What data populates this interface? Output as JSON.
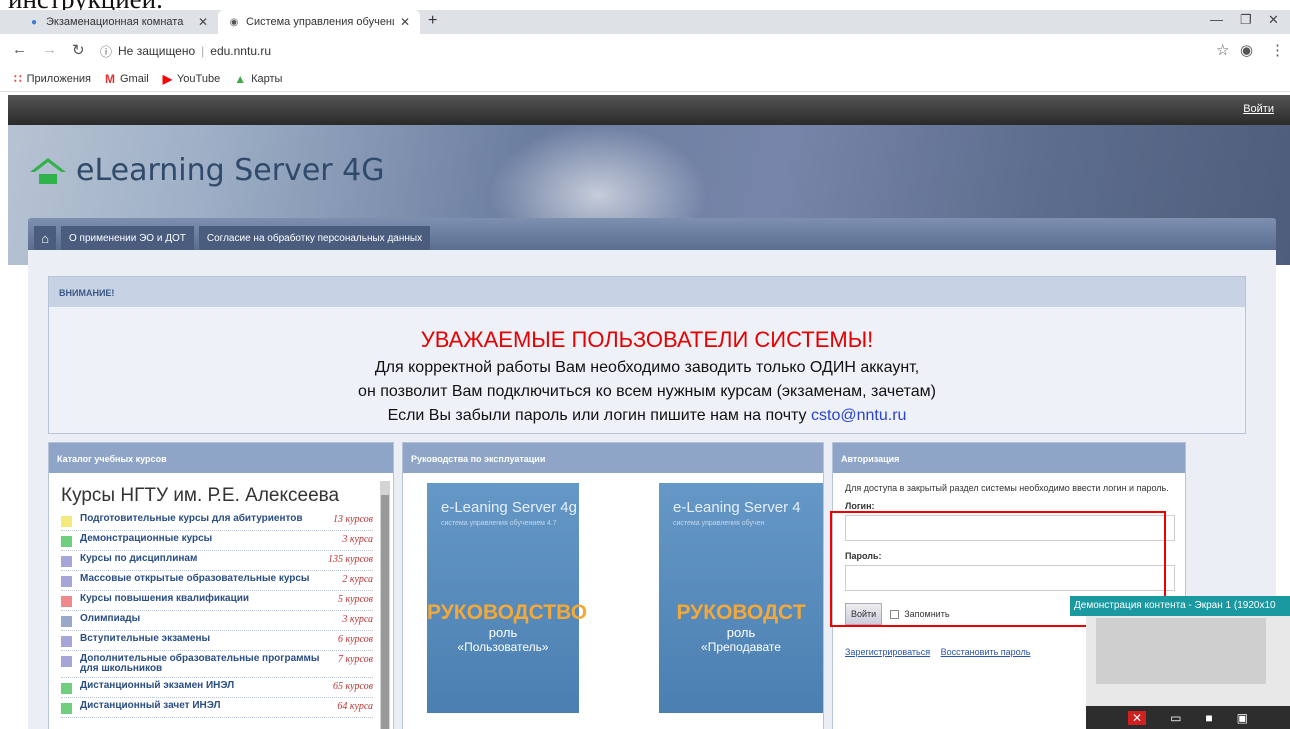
{
  "doc_text": "инструкцией.",
  "browser": {
    "tabs": [
      {
        "title": "Экзаменационная комната",
        "icon": "people-icon",
        "active": false
      },
      {
        "title": "Система управления обучением",
        "icon": "globe-icon",
        "active": true
      }
    ],
    "security": "Не защищено",
    "url": "edu.nntu.ru",
    "bookmarks": [
      "Приложения",
      "Gmail",
      "YouTube",
      "Карты"
    ]
  },
  "site": {
    "login_link": "Войти",
    "logo_title": "eLearning Server 4G",
    "nav": [
      "О применении ЭО и ДОТ",
      "Согласие на обработку персональных данных"
    ],
    "attention": {
      "header": "ВНИМАНИЕ!",
      "title": "УВАЖАЕМЫЕ ПОЛЬЗОВАТЕЛИ СИСТЕМЫ!",
      "line1": "Для корректной работы Вам необходимо заводить только ОДИН аккаунт,",
      "line2": "он позволит Вам подключиться ко всем нужным курсам (экзаменам, зачетам)",
      "line3": "Если Вы забыли пароль или логин пишите нам на почту",
      "email": "csto@nntu.ru"
    },
    "catalog": {
      "header": "Каталог учебных курсов",
      "subtitle": "Курсы НГТУ им. Р.Е. Алексеева",
      "items": [
        {
          "name": "Подготовительные курсы для абитуриентов",
          "count": "13 курсов",
          "color": "#f2ea7a"
        },
        {
          "name": "Демонстрационные курсы",
          "count": "3 курса",
          "color": "#6fcf7f"
        },
        {
          "name": "Курсы по дисциплинам",
          "count": "135 курсов",
          "color": "#a5a5d8"
        },
        {
          "name": "Массовые открытые образовательные курсы",
          "count": "2 курса",
          "color": "#a5a5d8"
        },
        {
          "name": "Курсы повышения квалификации",
          "count": "5 курсов",
          "color": "#f08a8a"
        },
        {
          "name": "Олимпиады",
          "count": "3 курса",
          "color": "#9aa8c8"
        },
        {
          "name": "Вступительные экзамены",
          "count": "6 курсов",
          "color": "#a5a5d8"
        },
        {
          "name": "Дополнительные образовательные программы для школьников",
          "count": "7 курсов",
          "color": "#a5a5d8"
        },
        {
          "name": "Дистанционный экзамен ИНЭЛ",
          "count": "65 курсов",
          "color": "#6fcf7f"
        },
        {
          "name": "Дистанционный зачет ИНЭЛ",
          "count": "64 курса",
          "color": "#6fcf7f"
        }
      ]
    },
    "manuals": {
      "header": "Руководства по эксплуатации",
      "books": [
        {
          "title": "e-Leaning Server 4g",
          "subtitle": "система управления обучением 4.7",
          "heading": "РУКОВОДСТВО",
          "role": "роль",
          "who": "«Пользователь»"
        },
        {
          "title": "e-Leaning Server 4",
          "subtitle": "система управления обучен",
          "heading": "РУКОВОДСТ",
          "role": "роль",
          "who": "«Преподавате"
        }
      ]
    },
    "auth": {
      "header": "Авторизация",
      "desc": "Для доступа в закрытый раздел системы необходимо ввести логин и пароль.",
      "login_label": "Логин:",
      "password_label": "Пароль:",
      "submit": "Войти",
      "remember": "Запомнить",
      "register": "Зарегистрироваться",
      "restore": "Восстановить пароль"
    }
  },
  "share_overlay": {
    "title": "Демонстрация контента - Экран 1 (1920x10"
  }
}
